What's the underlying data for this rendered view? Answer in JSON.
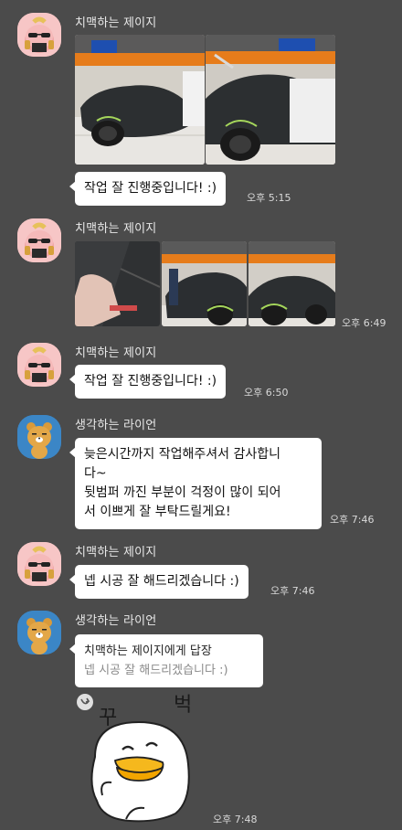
{
  "messages": [
    {
      "sender": "치맥하는 제이지",
      "text": "작업 잘 진행중입니다! :)",
      "time": "오후 5:15"
    },
    {
      "sender": "치맥하는 제이지",
      "time": "오후 6:49"
    },
    {
      "sender": "치맥하는 제이지",
      "text": "작업 잘 진행중입니다! :)",
      "time": "오후 6:50"
    },
    {
      "sender": "생각하는 라이언",
      "lines": [
        "늦은시간까지 작업해주셔서 감사합니",
        "다~",
        "뒷범퍼 까진 부분이 걱정이 많이 되어",
        "서 이쁘게 잘 부탁드릴게요!"
      ],
      "time": "오후 7:46"
    },
    {
      "sender": "치맥하는 제이지",
      "text": "넵 시공 잘 해드리겠습니다 :)",
      "time": "오후 7:46"
    },
    {
      "sender": "생각하는 라이언",
      "reply_to": "치맥하는 제이지에게 답장",
      "quoted": "넵 시공 잘 해드리겠습니다 :)",
      "time": "오후 7:48"
    }
  ],
  "sticker": {
    "text_left": "꾸",
    "text_right": "벅"
  },
  "colors": {
    "background": "#4b4b4b",
    "bubble": "#ffffff",
    "name": "#e8e8e8"
  }
}
